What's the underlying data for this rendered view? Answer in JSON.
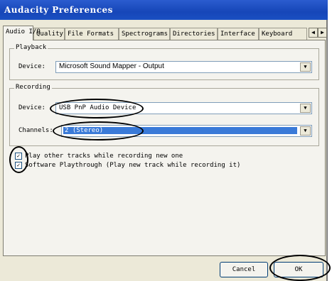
{
  "window": {
    "title": "Audacity Preferences"
  },
  "tabs": [
    {
      "label": "Audio I/O"
    },
    {
      "label": "Quality"
    },
    {
      "label": "File Formats"
    },
    {
      "label": "Spectrograms"
    },
    {
      "label": "Directories"
    },
    {
      "label": "Interface"
    },
    {
      "label": "Keyboard"
    }
  ],
  "playback": {
    "group_title": "Playback",
    "device_label": "Device:",
    "device_value": "Microsoft Sound Mapper - Output"
  },
  "recording": {
    "group_title": "Recording",
    "device_label": "Device:",
    "device_value": "USB PnP Audio Device",
    "channels_label": "Channels:",
    "channels_value": "2 (Stereo)"
  },
  "options": [
    {
      "label": "Play other tracks while recording new one",
      "checked": true
    },
    {
      "label": "Software Playthrough (Play new track while recording it)",
      "checked": true
    }
  ],
  "buttons": {
    "cancel": "Cancel",
    "ok": "OK"
  },
  "glyphs": {
    "check": "✓",
    "dropdown": "▼",
    "scroll_left": "◀",
    "scroll_right": "▶"
  }
}
